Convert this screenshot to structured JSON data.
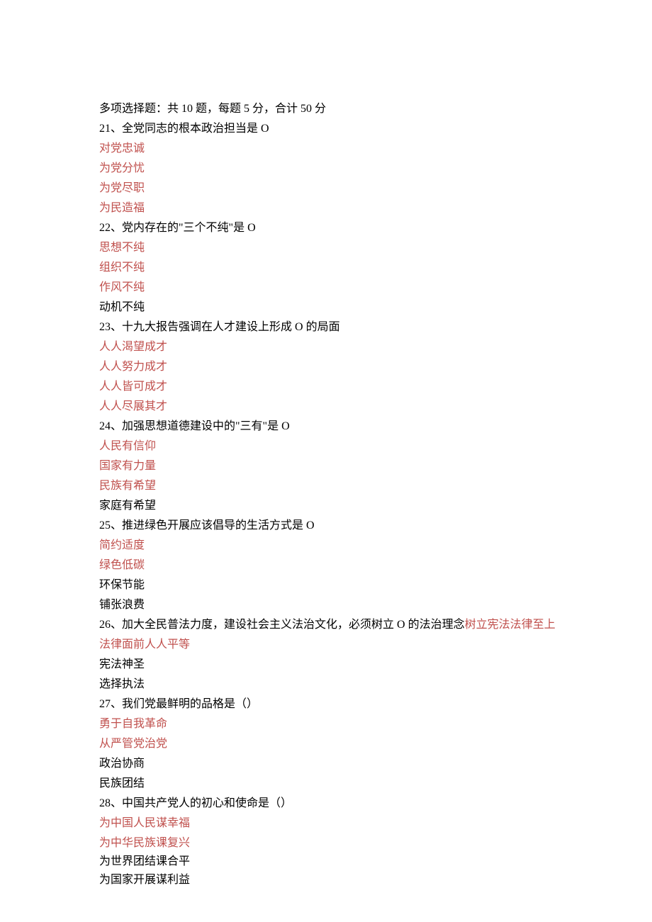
{
  "header": "多项选择题：共 10 题，每题 5 分，合计 50 分",
  "questions": [
    {
      "num": "21、",
      "stem": "全党同志的根本政治担当是 O",
      "options": [
        {
          "text": "对党忠诚",
          "correct": true
        },
        {
          "text": "为党分忧",
          "correct": true
        },
        {
          "text": "为党尽职",
          "correct": true
        },
        {
          "text": "为民造福",
          "correct": true
        }
      ]
    },
    {
      "num": "22、",
      "stem": "党内存在的\"三个不纯\"是 O",
      "options": [
        {
          "text": "思想不纯",
          "correct": true
        },
        {
          "text": "组织不纯",
          "correct": true
        },
        {
          "text": "作风不纯",
          "correct": true
        },
        {
          "text": "动机不纯",
          "correct": false
        }
      ]
    },
    {
      "num": "23、",
      "stem": "十九大报告强调在人才建设上形成 O 的局面",
      "options": [
        {
          "text": "人人渴望成才",
          "correct": true
        },
        {
          "text": "人人努力成才",
          "correct": true
        },
        {
          "text": "人人皆可成才",
          "correct": true
        },
        {
          "text": "人人尽展其才",
          "correct": true
        }
      ]
    },
    {
      "num": "24、",
      "stem": "加强思想道德建设中的\"三有\"是 O",
      "options": [
        {
          "text": "人民有信仰",
          "correct": true
        },
        {
          "text": "国家有力量",
          "correct": true
        },
        {
          "text": "民族有希望",
          "correct": true
        },
        {
          "text": "家庭有希望",
          "correct": false
        }
      ]
    },
    {
      "num": "25、",
      "stem": "推进绿色开展应该倡导的生活方式是 O",
      "options": [
        {
          "text": "简约适度",
          "correct": true
        },
        {
          "text": "绿色低碳",
          "correct": true
        },
        {
          "text": "环保节能",
          "correct": false
        },
        {
          "text": "铺张浪费",
          "correct": false
        }
      ]
    },
    {
      "num": "26、",
      "stem": "加大全民普法力度，建设社会主义法治文化，必须树立 O 的法治理念",
      "inline_option": "树立宪法法律至上",
      "options": [
        {
          "text": "法律面前人人平等",
          "correct": true
        },
        {
          "text": "宪法神圣",
          "correct": false
        },
        {
          "text": "选择执法",
          "correct": false
        }
      ]
    },
    {
      "num": "27、",
      "stem": "我们党最鲜明的品格是（）",
      "options": [
        {
          "text": "勇于自我革命",
          "correct": true
        },
        {
          "text": "从严管党治党",
          "correct": true
        },
        {
          "text": "政治协商",
          "correct": false
        },
        {
          "text": "民族团结",
          "correct": false
        }
      ]
    },
    {
      "num": "28、",
      "stem": "中国共产党人的初心和使命是（）",
      "options": [
        {
          "text": "为中国人民谋幸福",
          "correct": true
        },
        {
          "text": "为中华民族课复兴",
          "correct": true
        },
        {
          "text": "为世界团结课合平",
          "correct": false,
          "tight": true
        },
        {
          "text": "为国家开展谋利益",
          "correct": false
        }
      ]
    }
  ]
}
